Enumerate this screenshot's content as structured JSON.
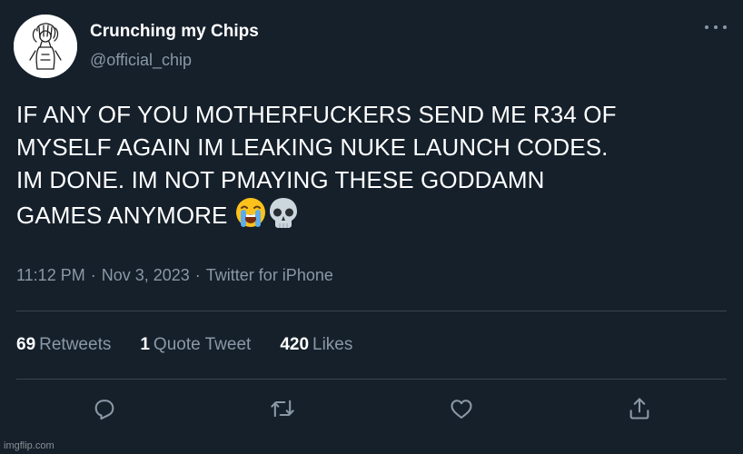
{
  "author": {
    "display_name": "Crunching my Chips",
    "handle": "@official_chip",
    "avatar_icon": "sketch-portrait-avatar"
  },
  "tweet": {
    "lines": [
      "IF ANY OF YOU MOTHERFUCKERS SEND ME R34 OF",
      "MYSELF AGAIN IM LEAKING NUKE LAUNCH CODES.",
      "IM DONE. IM NOT PMAYING THESE GODDAMN",
      "GAMES ANYMORE"
    ],
    "emojis": [
      "loudly-crying-face",
      "skull"
    ]
  },
  "meta": {
    "time": "11:12 PM",
    "separator": "·",
    "date": "Nov 3, 2023",
    "source": "Twitter for iPhone"
  },
  "stats": {
    "retweets_count": "69",
    "retweets_label": "Retweets",
    "quotes_count": "1",
    "quotes_label": "Quote Tweet",
    "likes_count": "420",
    "likes_label": "Likes"
  },
  "actions": [
    "reply-icon",
    "retweet-icon",
    "like-icon",
    "share-icon"
  ],
  "watermark": "imgflip.com",
  "colors": {
    "background": "#15202b",
    "text": "#ffffff",
    "secondary": "#8b98a5",
    "divider": "#38444d"
  }
}
